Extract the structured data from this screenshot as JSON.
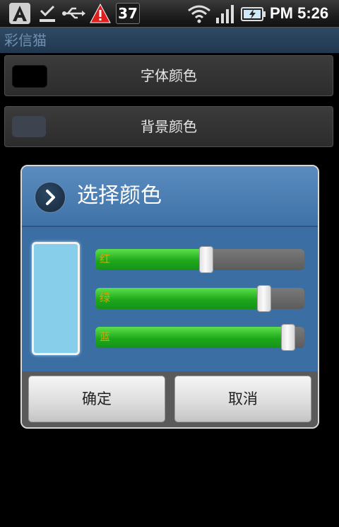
{
  "status_bar": {
    "icons": [
      "app-a-icon",
      "download-done-icon",
      "usb-icon",
      "warning-icon",
      "wifi-icon",
      "signal-icon",
      "battery-charging-icon"
    ],
    "badge": "37",
    "time": "PM 5:26"
  },
  "app_title": "彩信猫",
  "prefs": [
    {
      "label": "字体颜色",
      "swatch_color": "#000000"
    },
    {
      "label": "背景颜色",
      "swatch_color": "#3d4450"
    }
  ],
  "dialog": {
    "title": "选择颜色",
    "preview_color": "#87ceeb",
    "sliders": [
      {
        "label": "红",
        "value": 135,
        "max": 255
      },
      {
        "label": "绿",
        "value": 206,
        "max": 255
      },
      {
        "label": "蓝",
        "value": 235,
        "max": 255
      }
    ],
    "ok_label": "确定",
    "cancel_label": "取消"
  }
}
